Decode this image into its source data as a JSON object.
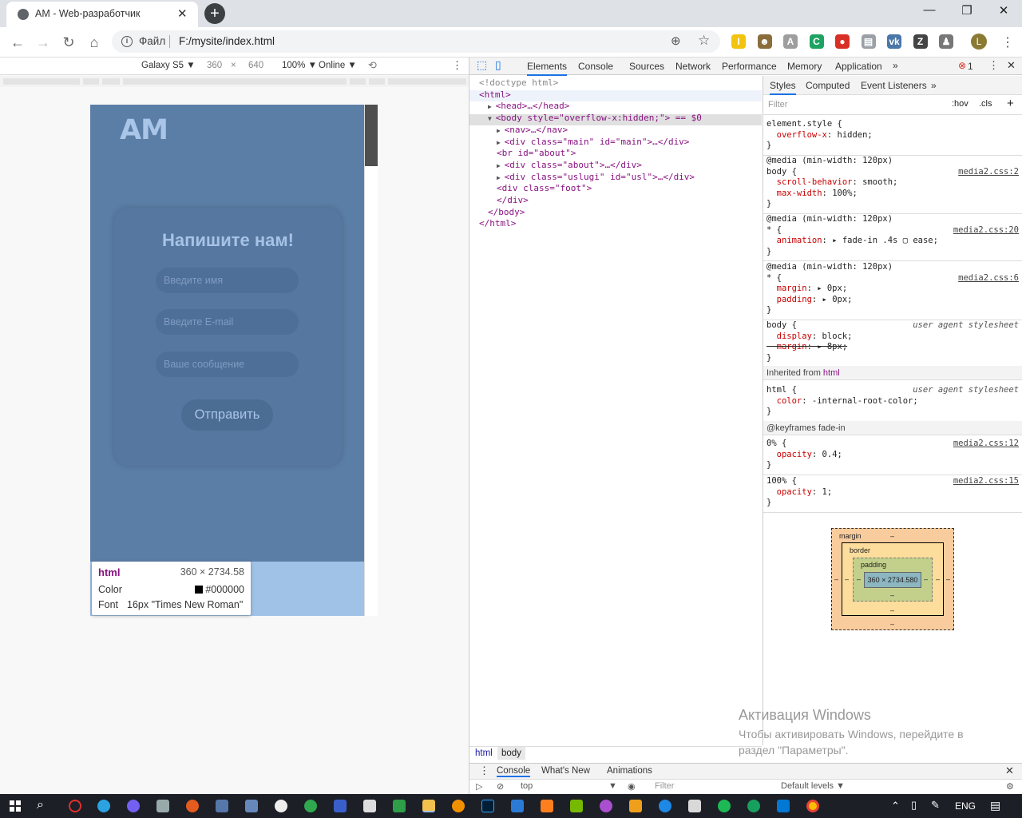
{
  "browser": {
    "tab_title": "AM - Web-разработчик",
    "tab_close": "✕",
    "new_tab": "+",
    "window_buttons": {
      "minimize": "—",
      "restore": "❐",
      "close": "✕"
    },
    "nav": {
      "back": "←",
      "forward": "→",
      "reload": "↻",
      "home": "⌂"
    },
    "omnibox": {
      "info_icon": "i",
      "scheme_label": "Файл",
      "url": "F:/mysite/index.html"
    },
    "extensions": [
      {
        "name": "extension-1",
        "letter": "I",
        "color": "#f2c40f"
      },
      {
        "name": "extension-2",
        "letter": "☻",
        "color": "#8a6d3b"
      },
      {
        "name": "extension-3",
        "letter": "A",
        "color": "#9e9e9e"
      },
      {
        "name": "extension-4",
        "letter": "C",
        "color": "#1ea362"
      },
      {
        "name": "extension-5",
        "letter": "●",
        "color": "#d93025"
      },
      {
        "name": "extension-6",
        "letter": "▤",
        "color": "#9aa0a6"
      },
      {
        "name": "extension-7",
        "letter": "vk",
        "color": "#4a76a8"
      },
      {
        "name": "extension-8",
        "letter": "Z",
        "color": "#444444"
      },
      {
        "name": "extension-9",
        "letter": "♟",
        "color": "#777777"
      }
    ],
    "profile_letter": "L",
    "menu_icon": "⋮"
  },
  "device_toolbar": {
    "device": "Galaxy S5 ▼",
    "width": "360",
    "times": "×",
    "height": "640",
    "zoom": "100% ▼",
    "network": "Online ▼",
    "rotate_icon": "⟲",
    "more": "⋮"
  },
  "site": {
    "logo": "AM",
    "form_title": "Напишите нам!",
    "name_placeholder": "Введите имя",
    "email_placeholder": "Введите E-mail",
    "message_placeholder": "Ваше сообщение",
    "submit_label": "Отправить"
  },
  "tooltip": {
    "tag": "html",
    "size": "360 × 2734.58",
    "color_label": "Color",
    "color_value": "#000000",
    "font_label": "Font",
    "font_value": "16px \"Times New Roman\""
  },
  "devtools": {
    "tabs": [
      "Elements",
      "Console",
      "Sources",
      "Network",
      "Performance",
      "Memory",
      "Application"
    ],
    "more_tabs": "»",
    "error_count": "1",
    "elements": [
      {
        "text": "<!doctype html>",
        "indent": 0,
        "arrow": ""
      },
      {
        "text": "<html>",
        "indent": 0,
        "arrow": ""
      },
      {
        "text": "<head>…</head>",
        "indent": 1,
        "arrow": "▶"
      },
      {
        "text": "<body style=\"overflow-x:hidden;\"> == $0",
        "indent": 1,
        "arrow": "▼"
      },
      {
        "text": "<nav>…</nav>",
        "indent": 2,
        "arrow": "▶"
      },
      {
        "text": "<div class=\"main\" id=\"main\">…</div>",
        "indent": 2,
        "arrow": "▶"
      },
      {
        "text": "<br id=\"about\">",
        "indent": 2,
        "arrow": ""
      },
      {
        "text": "<div class=\"about\">…</div>",
        "indent": 2,
        "arrow": "▶"
      },
      {
        "text": "<div class=\"uslugi\" id=\"usl\">…</div>",
        "indent": 2,
        "arrow": "▶"
      },
      {
        "text": "<div class=\"foot\">",
        "indent": 2,
        "arrow": ""
      },
      {
        "text": "</div>",
        "indent": 2,
        "arrow": ""
      },
      {
        "text": "</body>",
        "indent": 1,
        "arrow": ""
      },
      {
        "text": "</html>",
        "indent": 0,
        "arrow": ""
      }
    ],
    "breadcrumbs": [
      "html",
      "body"
    ],
    "styles_tabs": [
      "Styles",
      "Computed",
      "Event Listeners"
    ],
    "filter_placeholder": "Filter",
    "hov": ":hov",
    "cls": ".cls",
    "add": "+",
    "rules": [
      {
        "lines": [
          "element.style {",
          "  overflow-x: hidden;",
          "}"
        ],
        "source": "",
        "ua": ""
      },
      {
        "lines": [
          "@media (min-width: 120px)",
          "body {",
          "  scroll-behavior: smooth;",
          "  max-width: 100%;",
          "}"
        ],
        "source": "media2.css:2",
        "ua": ""
      },
      {
        "lines": [
          "@media (min-width: 120px)",
          "* {",
          "  animation: ▸ fade-in .4s ▢ ease;",
          "}"
        ],
        "source": "media2.css:20",
        "ua": ""
      },
      {
        "lines": [
          "@media (min-width: 120px)",
          "* {",
          "  margin: ▸ 0px;",
          "  padding: ▸ 0px;",
          "}"
        ],
        "source": "media2.css:6",
        "ua": ""
      },
      {
        "lines": [
          "body {",
          "  display: block;",
          "  margin: ▸ 8px;",
          "}"
        ],
        "source": "",
        "ua": "user agent stylesheet"
      }
    ],
    "inherited_label": "Inherited from",
    "inherited_tag": "html",
    "html_rule": {
      "lines": [
        "html {",
        "  color: -internal-root-color;",
        "}"
      ],
      "ua": "user agent stylesheet"
    },
    "keyframes_label": "@keyframes fade-in",
    "kf0": {
      "lines": [
        "0% {",
        "  opacity: 0.4;",
        "}"
      ],
      "source": "media2.css:12"
    },
    "kf100": {
      "lines": [
        "100% {",
        "  opacity: 1;",
        "}"
      ],
      "source": "media2.css:15"
    },
    "box_model": {
      "margin": "margin",
      "border": "border",
      "padding": "padding",
      "content": "360 × 2734.580",
      "dash": "–"
    },
    "drawer_tabs": [
      "Console",
      "What's New",
      "Animations"
    ],
    "console_context": "top",
    "console_filter": "Filter",
    "levels": "Default levels ▼"
  },
  "watermark": {
    "title": "Активация Windows",
    "text": "Чтобы активировать Windows, перейдите в раздел \"Параметры\"."
  },
  "taskbar": {
    "language": "ENG"
  },
  "colors": {
    "site_bg": "#5b7ea6",
    "accent_light": "#a9c5e8",
    "devtools_tag": "#881280"
  }
}
